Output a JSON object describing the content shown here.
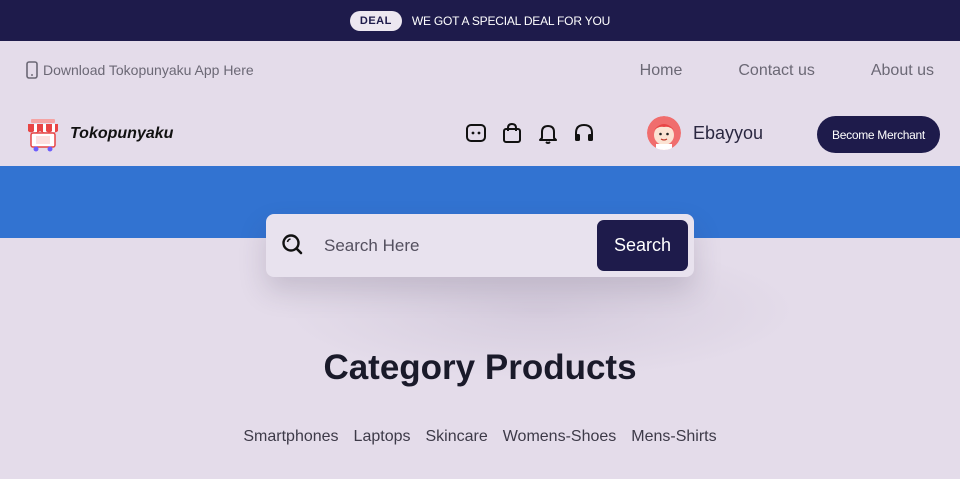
{
  "topbar": {
    "badge": "DEAL",
    "message": "WE GOT A SPECIAL DEAL FOR YOU"
  },
  "infobar": {
    "app_link": "Download Tokopunyaku App Here",
    "nav": [
      "Home",
      "Contact us",
      "About us"
    ]
  },
  "header": {
    "logo_text": "Tokopunyaku",
    "icons": [
      "chat-icon",
      "shopping-bag-icon",
      "bell-icon",
      "headphones-icon"
    ],
    "username": "Ebayyou",
    "merchant_button": "Become Merchant"
  },
  "search": {
    "placeholder": "Search Here",
    "button": "Search"
  },
  "categories": {
    "title": "Category Products",
    "items": [
      "Smartphones",
      "Laptops",
      "Skincare",
      "Womens-Shoes",
      "Mens-Shirts"
    ]
  },
  "colors": {
    "navy": "#1e1b4b",
    "banner_blue": "#3273d1",
    "background": "#e4dcea"
  }
}
